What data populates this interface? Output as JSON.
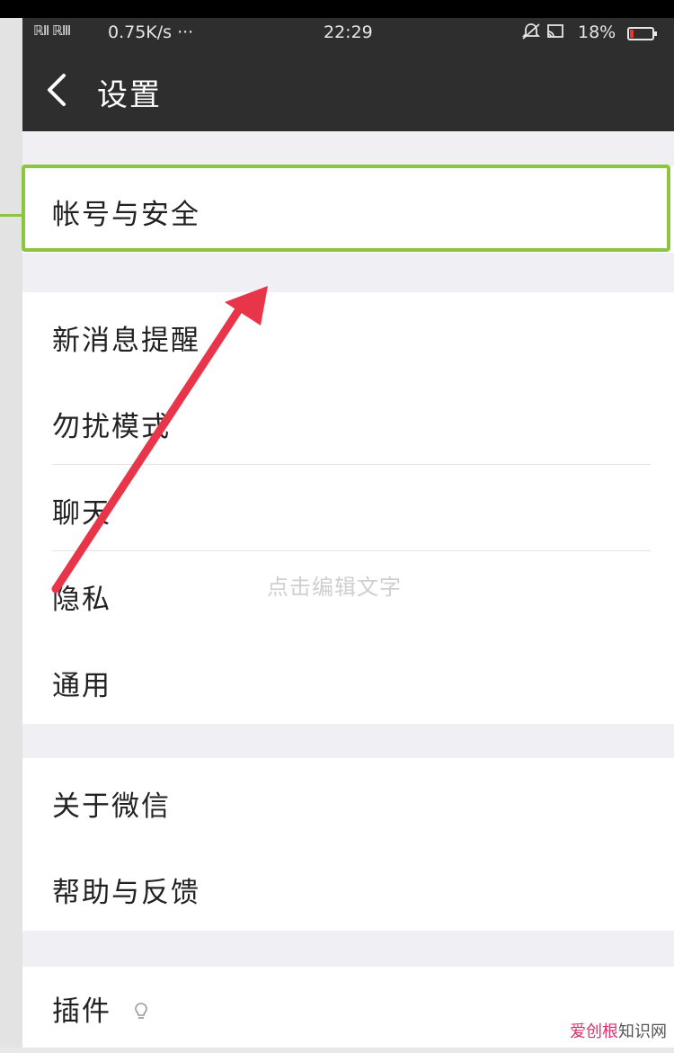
{
  "status_bar": {
    "signal": "ℝⅡ ℝⅢ",
    "speed": "0.75K/s ···",
    "time": "22:29",
    "battery_pct": "18%",
    "battery_level": 0.18,
    "icons": [
      "mute-icon",
      "cast-icon"
    ]
  },
  "nav": {
    "title": "设置",
    "back_icon": "back-chevron-icon"
  },
  "groups": {
    "account": {
      "items": [
        {
          "label": "帐号与安全"
        }
      ]
    },
    "main": {
      "items": [
        {
          "label": "新消息提醒"
        },
        {
          "label": "勿扰模式"
        },
        {
          "label": "聊天"
        },
        {
          "label": "隐私"
        },
        {
          "label": "通用"
        }
      ]
    },
    "about": {
      "items": [
        {
          "label": "关于微信"
        },
        {
          "label": "帮助与反馈"
        }
      ]
    },
    "plugins": {
      "items": [
        {
          "label": "插件",
          "icon": "plugin-icon"
        }
      ]
    }
  },
  "overlay": {
    "watermark_text": "点击编辑文字",
    "highlight_color": "#8cc63f",
    "arrow_color": "#e8354a"
  },
  "corner_watermark": {
    "brand": "爱创根",
    "suffix": "知识网"
  },
  "colors": {
    "header_bg": "#2e2e2e",
    "page_bg": "#efeff4",
    "battery_low": "#e8352f"
  }
}
